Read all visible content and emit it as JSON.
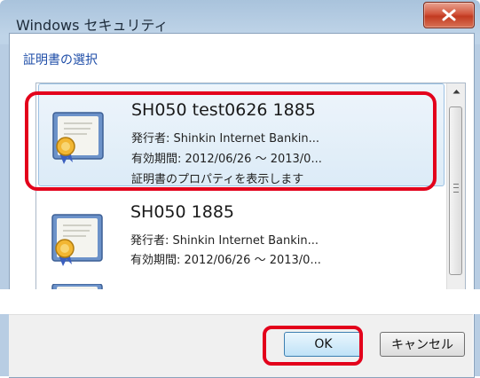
{
  "window": {
    "title": "Windows セキュリティ",
    "close_icon": "close-icon"
  },
  "section_title": "証明書の選択",
  "certificates": [
    {
      "name": "SH050 test0626 1885",
      "issuer": "発行者: Shinkin Internet Bankin...",
      "validity": "有効期間: 2012/06/26 ～ 2013/0...",
      "properties_link": "証明書のプロパティを表示します",
      "selected": true
    },
    {
      "name": "SH050  1885",
      "issuer": "発行者: Shinkin Internet Bankin...",
      "validity": "有効期間: 2012/06/26 ～ 2013/0...",
      "selected": false
    }
  ],
  "buttons": {
    "ok": "OK",
    "cancel": "キャンセル"
  },
  "colors": {
    "highlight": "#e3001b",
    "link": "#1f4ea8"
  }
}
